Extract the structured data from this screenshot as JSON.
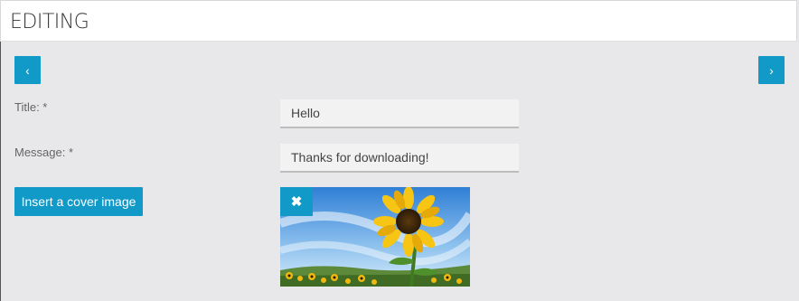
{
  "header": {
    "title": "EDITING"
  },
  "nav": {
    "prev_glyph": "‹",
    "next_glyph": "›"
  },
  "form": {
    "title_label": "Title: *",
    "title_value": "Hello",
    "message_label": "Message: *",
    "message_value": "Thanks for downloading!",
    "cover_button": "Insert a cover image",
    "remove_glyph": "✖"
  },
  "colors": {
    "accent": "#1199c8",
    "background": "#e8e8ea",
    "header_bg": "#ffffff"
  },
  "cover_image": {
    "subject": "sunflower-field-photo"
  }
}
